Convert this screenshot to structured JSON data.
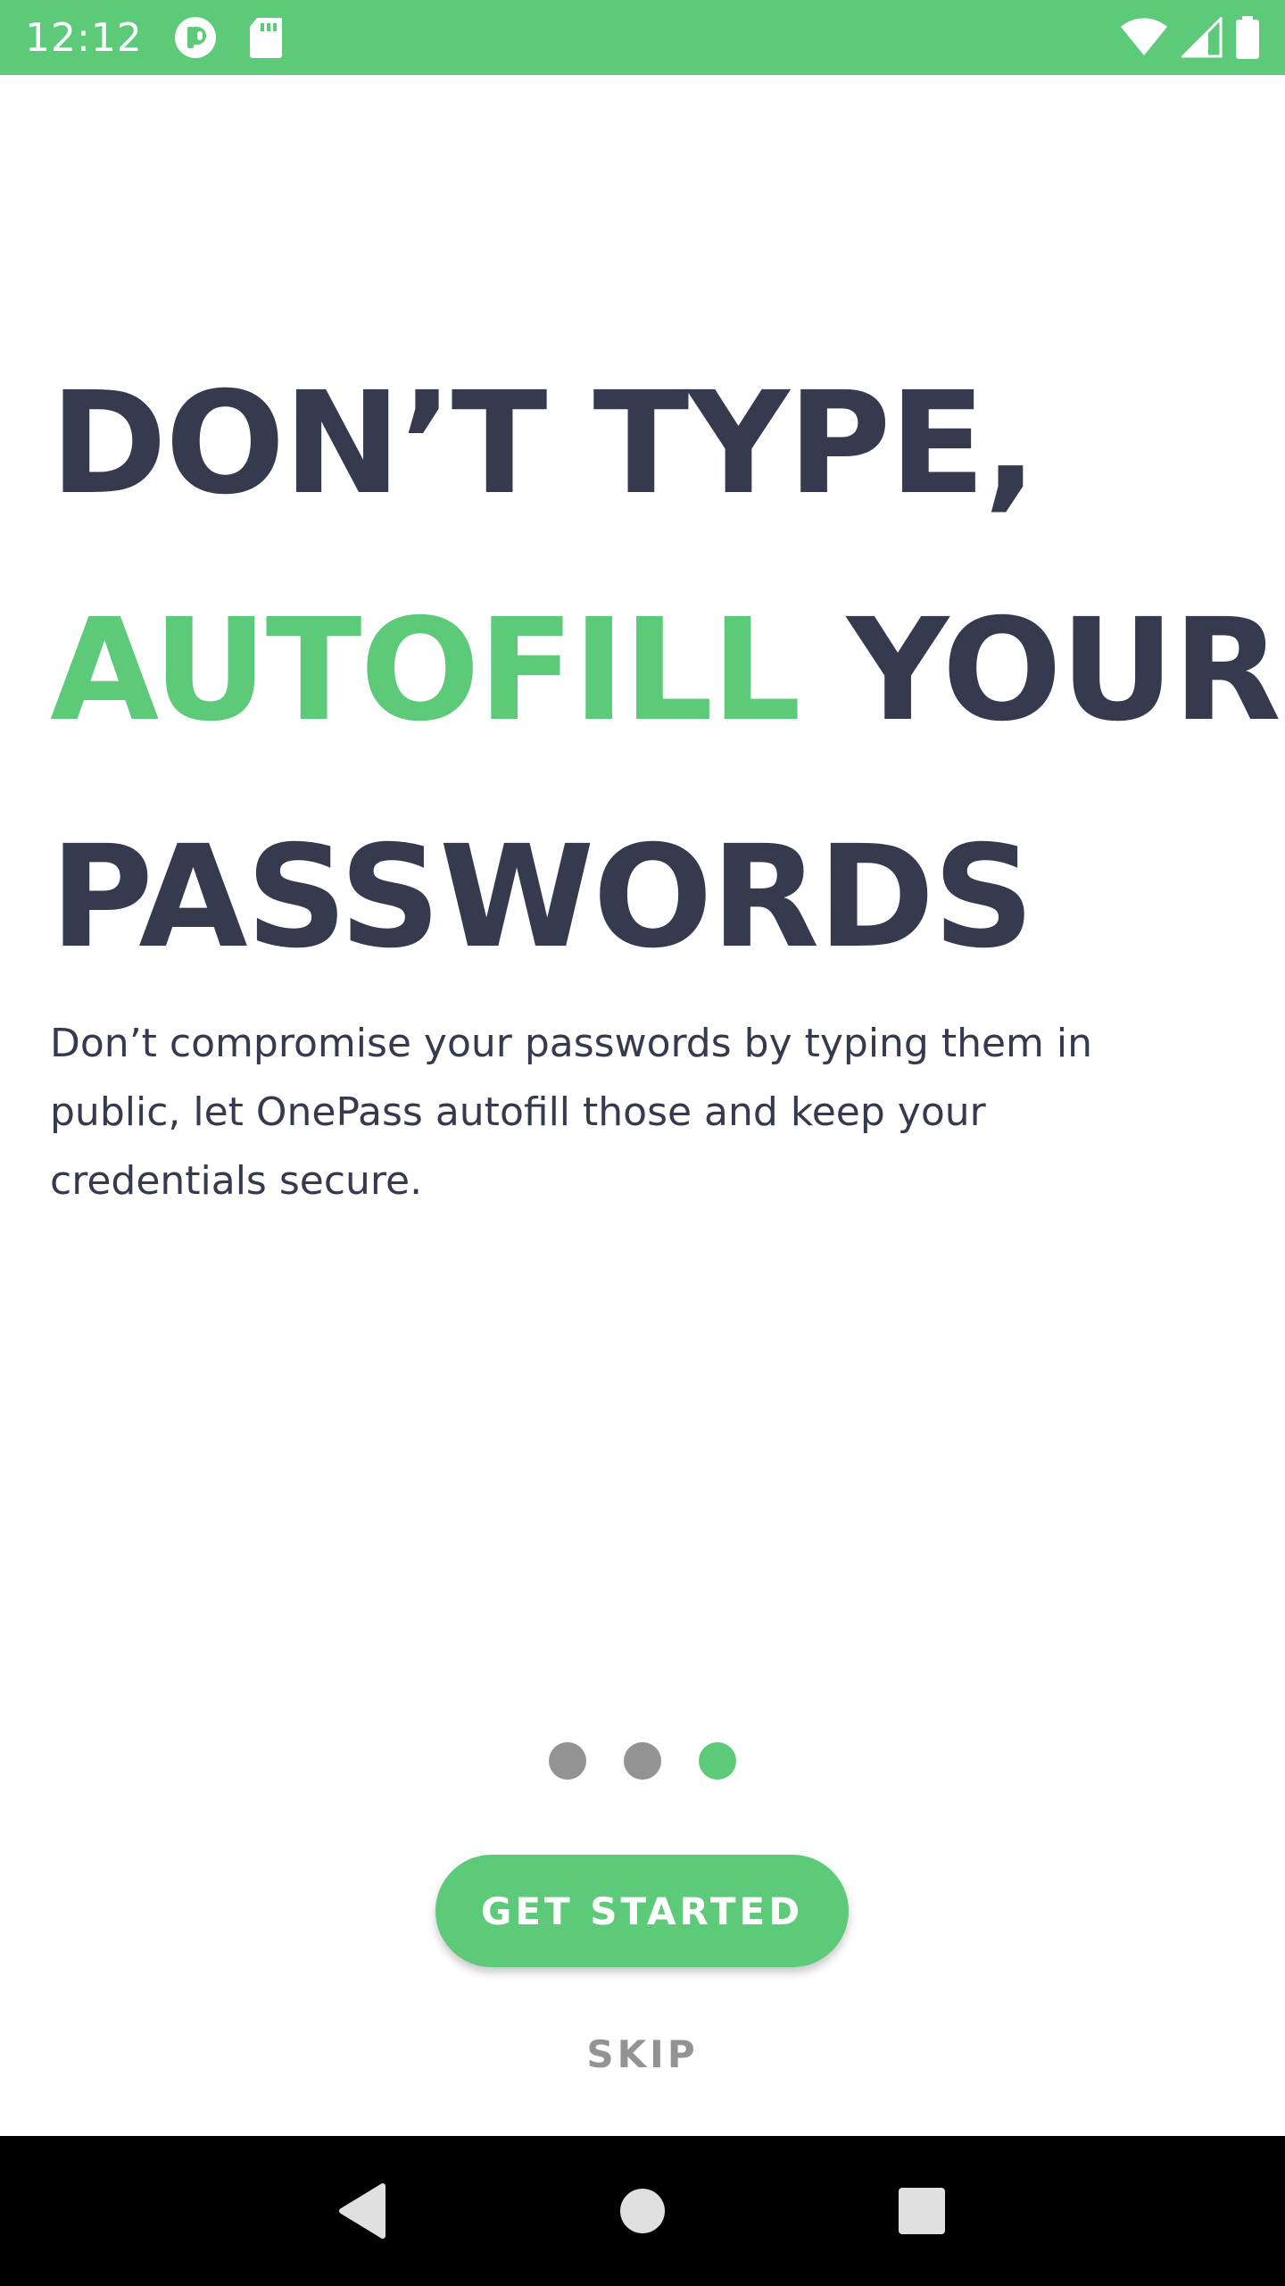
{
  "status_bar": {
    "time": "12:12",
    "icons_left": [
      "app-notification-icon",
      "sd-card-icon"
    ],
    "icons_right": [
      "wifi-icon",
      "cell-signal-icon",
      "battery-icon"
    ],
    "background": "#5dca7a"
  },
  "onboarding": {
    "headline_line1": "DON’T TYPE,",
    "headline_accent": "AUTOFILL",
    "headline_line2_rest": " YOUR",
    "headline_line3": "PASSWORDS",
    "description": "Don’t compromise your passwords by typing them in public, let OnePass autofill those and keep your credentials secure.",
    "page_count": 3,
    "active_page": 3,
    "get_started_label": "GET STARTED",
    "skip_label": "SKIP"
  },
  "colors": {
    "accent": "#5dca7a",
    "text_dark": "#363a4f",
    "muted": "#939393"
  },
  "navigation_bar": {
    "buttons": [
      "back-icon",
      "home-icon",
      "recents-icon"
    ]
  }
}
